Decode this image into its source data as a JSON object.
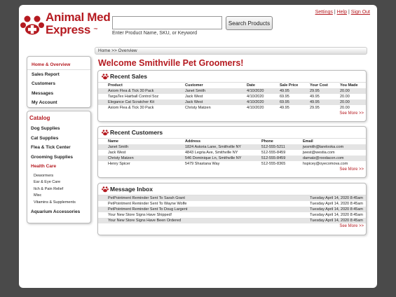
{
  "header": {
    "brand_line1": "Animal Med",
    "brand_line2": "Express",
    "brand_tm": "™",
    "search_placeholder": "",
    "search_hint": "Enter Product Name, SKU, or Keyword",
    "search_button": "Search Products",
    "links": {
      "settings": "Settings",
      "help": "Help",
      "signout": "Sign Out",
      "sep": "|"
    }
  },
  "colors": {
    "brand": "#b51a20",
    "frame_bg": "#4a4a4a",
    "row_stripe": "#e4e4e4"
  },
  "sidebar": {
    "items": [
      {
        "label": "Home & Overview",
        "active": true
      },
      {
        "label": "Sales Report"
      },
      {
        "label": "Customers"
      },
      {
        "label": "Messages"
      },
      {
        "label": "My Account"
      }
    ],
    "catalog_title": "Catalog",
    "categories": [
      {
        "label": "Dog Supplies"
      },
      {
        "label": "Cat Supplies"
      },
      {
        "label": "Flea & Tick Center"
      },
      {
        "label": "Grooming Supplies"
      },
      {
        "label": "Health Care",
        "active": true
      }
    ],
    "subcategories": [
      "Dewormers",
      "Ear & Eye Care",
      "Itch & Pain Relief",
      "Misc",
      "Vitamins & Supplements"
    ],
    "last_category": "Aquarium Accessories"
  },
  "main": {
    "breadcrumb": "Home >> Overview",
    "title": "Welcome Smithville Pet Groomers!",
    "recent_sales": {
      "title": "Recent Sales",
      "columns": [
        "Product",
        "Customer",
        "Date",
        "Sale Price",
        "Your Cost",
        "You Made"
      ],
      "rows": [
        [
          "Axiom Flea & Tick 30 Pack",
          "Janet Smith",
          "4/10/2020",
          "49.95",
          "29.95",
          "20.00"
        ],
        [
          "TargaTex Hairball Control 5oz",
          "Jack West",
          "4/10/2020",
          "69.95",
          "49.95",
          "20.00"
        ],
        [
          "Elegance Cat Scratcher Kit",
          "Jack West",
          "4/10/2020",
          "69.95",
          "49.95",
          "20.00"
        ],
        [
          "Axiom Flea & Tick 30 Pack",
          "Christy Matzen",
          "4/10/2020",
          "49.95",
          "29.95",
          "20.00"
        ]
      ],
      "see_more": "See More >>"
    },
    "recent_customers": {
      "title": "Recent Customers",
      "columns": [
        "Name",
        "Address",
        "Phone",
        "Email"
      ],
      "rows": [
        [
          "Janet Smith",
          "1824 Astoria Lane, Smithville NY",
          "512-555-5211",
          "jwsmith@larelooka.com"
        ],
        [
          "Jack West",
          "4843 Legria Ave, Smithville NY",
          "512-555-8459",
          "jwest@westia.com"
        ],
        [
          "Christy Matzen",
          "546 Dominique Ln, Smithville NY",
          "512-555-8459",
          "damatz@roodacon.com"
        ],
        [
          "Henry Spicer",
          "5479 Shastana Way",
          "512-555-8365",
          "hspicey@oyecomova.com"
        ]
      ],
      "see_more": "See More >>"
    },
    "message_inbox": {
      "title": "Message Inbox",
      "rows": [
        [
          "PetPointment Reminder Sent To Sarah Grant",
          "Tuesday April 14, 2020 8:45am"
        ],
        [
          "PetPointment Reminder Sent To Wayne Wolfe",
          "Tuesday April 14, 2020 8:45am"
        ],
        [
          "PetPointment Reminder Sent To Doug Largent",
          "Tuesday April 14, 2020 8:45am"
        ],
        [
          "Your New Store Signs Have Shipped!",
          "Tuesday April 14, 2020 8:45am"
        ],
        [
          "Your New Store Signs Have Been Ordered",
          "Tuesday April 14, 2020 8:45am"
        ]
      ],
      "see_more": "See More >>"
    }
  }
}
